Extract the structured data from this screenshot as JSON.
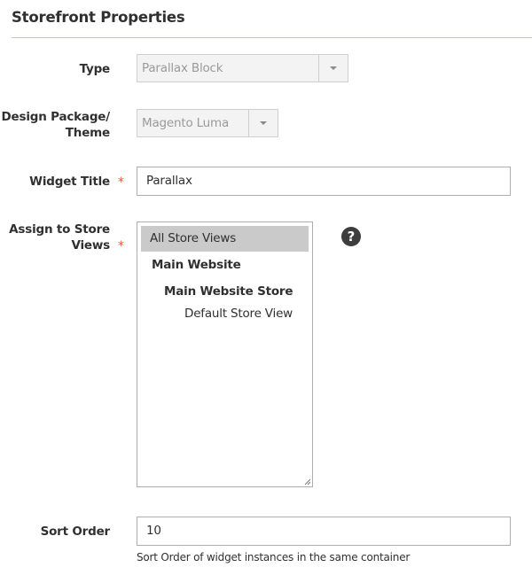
{
  "section": {
    "title": "Storefront Properties"
  },
  "fields": {
    "type": {
      "label": "Type",
      "value": "Parallax Block",
      "disabled": true
    },
    "theme": {
      "label_line1": "Design Package/",
      "label_line2": "Theme",
      "value": "Magento Luma",
      "disabled": true
    },
    "widget_title": {
      "label": "Widget Title",
      "value": "Parallax",
      "required": true
    },
    "store_views": {
      "label_line1": "Assign to Store",
      "label_line2": "Views",
      "required": true,
      "options": [
        {
          "label": "All Store Views",
          "selected": true,
          "level": 0
        },
        {
          "label": "Main Website",
          "group": true,
          "level": 0
        },
        {
          "label": "Main Website Store",
          "group": true,
          "level": 1
        },
        {
          "label": "Default Store View",
          "level": 2
        }
      ],
      "help_icon": "question-circle-icon",
      "help_glyph": "?"
    },
    "sort_order": {
      "label": "Sort Order",
      "value": "10",
      "note": "Sort Order of widget instances in the same container"
    }
  },
  "required_marker": "*",
  "colors": {
    "required": "#e35d34",
    "selected_option_bg": "#cacaca",
    "divider": "#c8c8c0"
  }
}
